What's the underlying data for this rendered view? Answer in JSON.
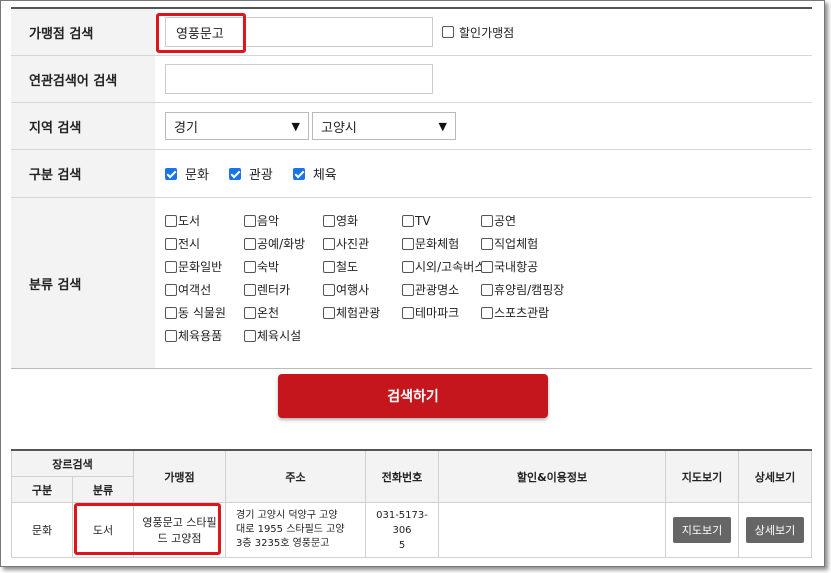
{
  "form": {
    "merchant": {
      "label": "가맹점 검색",
      "value": "영풍문고",
      "discount_label": "할인가맹점"
    },
    "related": {
      "label": "연관검색어 검색",
      "value": ""
    },
    "region": {
      "label": "지역 검색",
      "province": "경기",
      "city": "고양시"
    },
    "type": {
      "label": "구분 검색",
      "options": [
        "문화",
        "관광",
        "체육"
      ]
    },
    "category": {
      "label": "분류 검색",
      "rows": [
        [
          "도서",
          "음악",
          "영화",
          "TV",
          "공연"
        ],
        [
          "전시",
          "공예/화방",
          "사진관",
          "문화체험",
          "직업체험"
        ],
        [
          "문화일반",
          "숙박",
          "철도",
          "시외/고속버스",
          "국내항공"
        ],
        [
          "여객선",
          "렌터카",
          "여행사",
          "관광명소",
          "휴양림/캠핑장"
        ],
        [
          "동 식물원",
          "온천",
          "체험관광",
          "테마파크",
          "스포츠관람"
        ],
        [
          "체육용품",
          "체육시설"
        ]
      ]
    }
  },
  "search_button": "검색하기",
  "table": {
    "headers": {
      "genre": "장르검색",
      "type": "구분",
      "category": "분류",
      "merchant": "가맹점",
      "address": "주소",
      "phone": "전화번호",
      "info": "할인&이용정보",
      "map": "지도보기",
      "detail": "상세보기"
    },
    "rows": [
      {
        "type": "문화",
        "category": "도서",
        "merchant_line1": "영풍문고 스타필",
        "merchant_line2": "드 고양점",
        "address_line1": "경기 고양시 덕양구 고양",
        "address_line2": "대로 1955 스타필드 고양",
        "address_line3": "3층 3235호 영풍문고",
        "phone_line1": "031-5173-306",
        "phone_line2": "5",
        "info": "",
        "map_button": "지도보기",
        "detail_button": "상세보기"
      }
    ]
  }
}
